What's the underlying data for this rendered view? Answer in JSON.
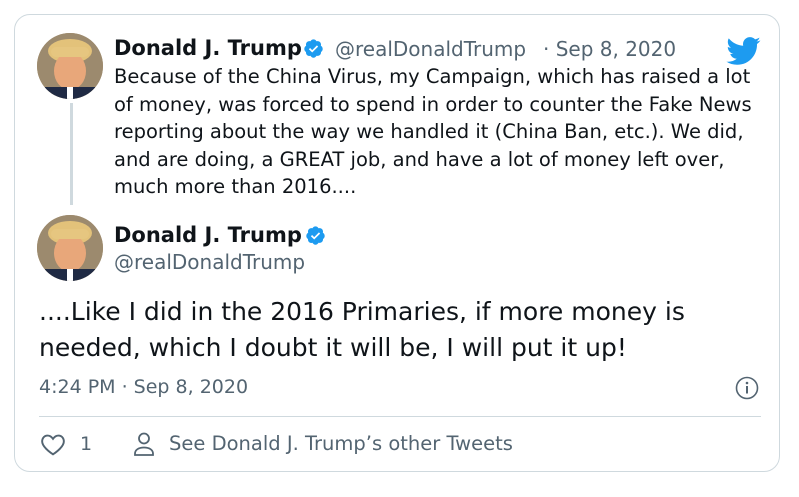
{
  "tweet1": {
    "name": "Donald J. Trump",
    "handle": "@realDonaldTrump",
    "date": "· Sep 8, 2020",
    "text": "Because of the China Virus, my Campaign, which has raised a lot of money, was forced to spend in order to counter the Fake News reporting about the way we handled it (China Ban, etc.). We did, and are doing, a GREAT job, and have a lot of money left over, much more than 2016...."
  },
  "tweet2": {
    "name": "Donald J. Trump",
    "handle": "@realDonaldTrump",
    "text": "....Like I did in the 2016 Primaries, if more money is needed, which I doubt it will be, I will put it up!",
    "timestamp": "4:24 PM · Sep 8, 2020"
  },
  "actions": {
    "like_count": "1",
    "other_tweets_label": "See Donald J. Trump’s other Tweets"
  },
  "colors": {
    "text": "#0f1419",
    "secondary": "#536471",
    "twitter_blue": "#1d9bf0",
    "border": "#cfd9de"
  },
  "icons": [
    "twitter-bird-icon",
    "verified-badge-icon",
    "info-icon",
    "heart-icon",
    "person-icon"
  ]
}
